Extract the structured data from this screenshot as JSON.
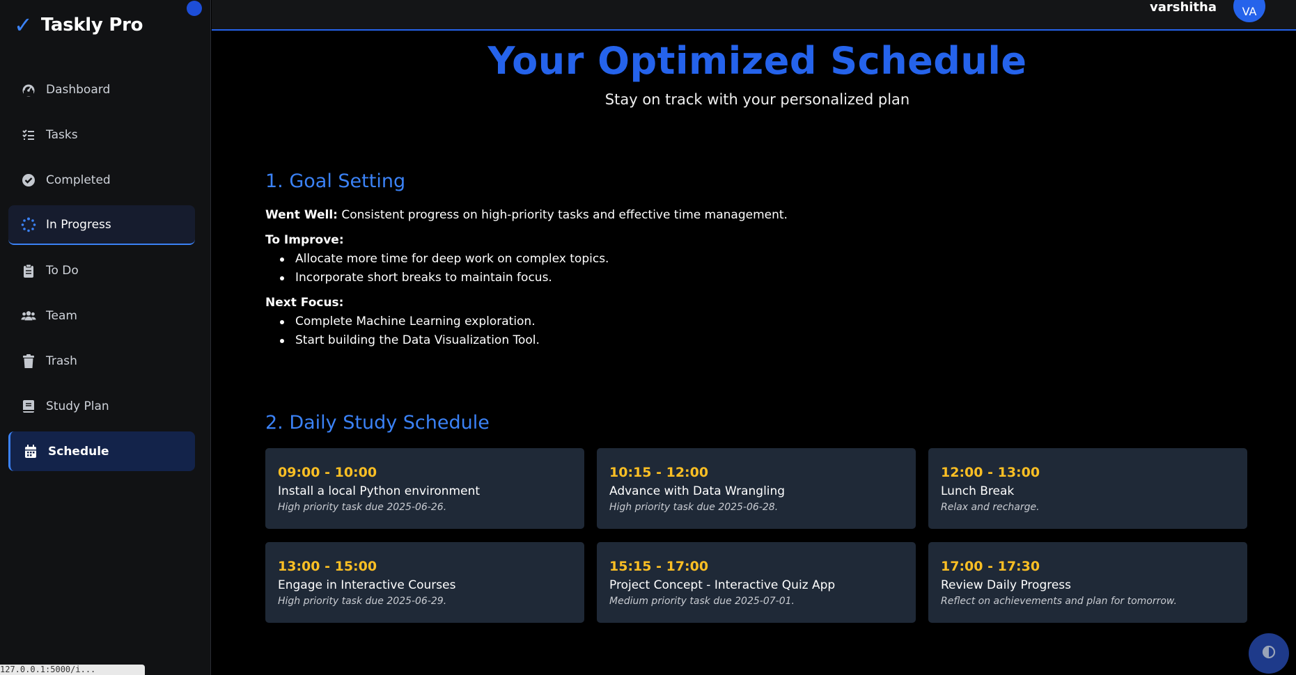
{
  "brand": {
    "name": "Taskly Pro",
    "check": "✓"
  },
  "sidebar": {
    "items": [
      {
        "label": "Dashboard",
        "icon": "dashboard-gauge-icon"
      },
      {
        "label": "Tasks",
        "icon": "task-list-icon"
      },
      {
        "label": "Completed",
        "icon": "check-circle-icon"
      },
      {
        "label": "In Progress",
        "icon": "spinner-icon"
      },
      {
        "label": "To Do",
        "icon": "clipboard-icon"
      },
      {
        "label": "Team",
        "icon": "users-icon"
      },
      {
        "label": "Trash",
        "icon": "trash-icon"
      },
      {
        "label": "Study Plan",
        "icon": "book-icon"
      },
      {
        "label": "Schedule",
        "icon": "calendar-icon"
      }
    ],
    "active": "Schedule"
  },
  "status_url": "127.0.0.1:5000/i...",
  "header": {
    "username": "varshitha",
    "avatar_initials": "VA"
  },
  "main": {
    "title": "Your Optimized Schedule",
    "subtitle": "Stay on track with your personalized plan",
    "goal_section": {
      "title": "1. Goal Setting",
      "went_well_label": "Went Well:",
      "went_well_text": "Consistent progress on high-priority tasks and effective time management.",
      "improve_label": "To Improve:",
      "improve_items": [
        "Allocate more time for deep work on complex topics.",
        "Incorporate short breaks to maintain focus."
      ],
      "next_label": "Next Focus:",
      "next_items": [
        "Complete Machine Learning exploration.",
        "Start building the Data Visualization Tool."
      ]
    },
    "schedule_section": {
      "title": "2. Daily Study Schedule",
      "slots": [
        {
          "time": "09:00 - 10:00",
          "task": "Install a local Python environment",
          "note": "High priority task due 2025-06-26."
        },
        {
          "time": "10:15 - 12:00",
          "task": "Advance with Data Wrangling",
          "note": "High priority task due 2025-06-28."
        },
        {
          "time": "12:00 - 13:00",
          "task": "Lunch Break",
          "note": "Relax and recharge."
        },
        {
          "time": "13:00 - 15:00",
          "task": "Engage in Interactive Courses",
          "note": "High priority task due 2025-06-29."
        },
        {
          "time": "15:15 - 17:00",
          "task": "Project Concept - Interactive Quiz App",
          "note": "Medium priority task due 2025-07-01."
        },
        {
          "time": "17:00 - 17:30",
          "task": "Review Daily Progress",
          "note": "Reflect on achievements and plan for tomorrow."
        }
      ]
    }
  },
  "colors": {
    "accent": "#2563eb",
    "time": "#fbbf24",
    "card": "#1f2937",
    "background": "#000000"
  }
}
